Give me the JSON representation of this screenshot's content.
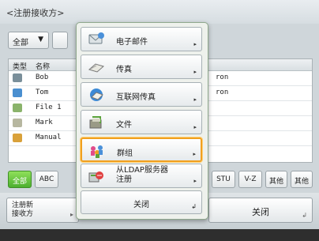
{
  "title": "<注册接收方>",
  "top": {
    "all_dropdown": "全部",
    "dropdown_caret": "▼"
  },
  "list": {
    "header_type": "类型",
    "header_name": "名称",
    "rows": [
      {
        "name": "Bob",
        "address": "ron"
      },
      {
        "name": "Tom",
        "address": "ron"
      },
      {
        "name": "File 1",
        "address": ""
      },
      {
        "name": "Mark",
        "address": ""
      },
      {
        "name": "Manual",
        "address": ""
      }
    ]
  },
  "filters": [
    "全部",
    "ABC",
    "STU",
    "V-Z",
    "其他",
    "其他"
  ],
  "bottom": {
    "register_label": "注册新\n接收方",
    "close_label": "关闭",
    "corner": "↲"
  },
  "menu": {
    "items": [
      {
        "label": "电子邮件",
        "icon": "email-icon"
      },
      {
        "label": "传真",
        "icon": "fax-icon"
      },
      {
        "label": "互联网传真",
        "icon": "internet-fax-icon"
      },
      {
        "label": "文件",
        "icon": "file-icon"
      },
      {
        "label": "群组",
        "icon": "group-icon",
        "selected": true
      },
      {
        "label": "从LDAP服务器\n注册",
        "icon": "ldap-server-icon"
      }
    ],
    "arrow": "▸",
    "close_label": "关闭",
    "close_icon": "↲"
  }
}
